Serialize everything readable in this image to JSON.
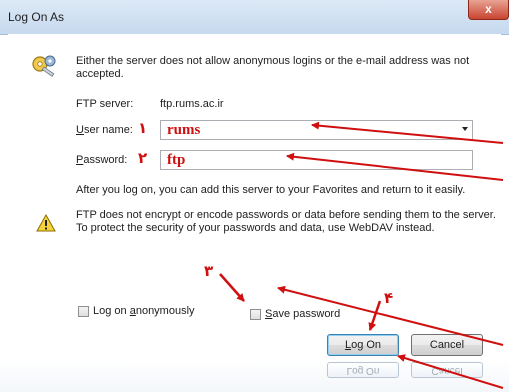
{
  "window": {
    "title": "Log On As",
    "close_glyph": "x"
  },
  "message": "Either the server does not allow anonymous logins or the e-mail address was not accepted.",
  "ftp_server": {
    "label": "FTP server:",
    "value": "ftp.rums.ac.ir"
  },
  "user_name": {
    "label_u": "U",
    "label_rest": "ser name:",
    "value": "rums",
    "marker": "۱"
  },
  "password": {
    "label_u": "P",
    "label_rest": "assword:",
    "value": "ftp",
    "marker": "۲"
  },
  "info_text": "After you log on, you can add this server to your Favorites and return to it easily.",
  "warning_text": "FTP does not encrypt or encode passwords or data before sending them to the server.  To protect the security of your passwords and data, use WebDAV instead.",
  "options": {
    "anonymous_pre": "Log on ",
    "anonymous_u": "a",
    "anonymous_post": "nonymously",
    "anonymous_checked": false,
    "save_u": "S",
    "save_rest": "ave password",
    "save_checked": false,
    "save_marker": "۳"
  },
  "buttons": {
    "logon_u": "L",
    "logon_rest": "og On",
    "cancel": "Cancel",
    "logon_marker": "۴"
  },
  "reflection": {
    "logon": "Log On",
    "cancel": "Cancel"
  },
  "colors": {
    "annotation": "#d01010",
    "title_bar": "#c6d9ee",
    "close": "#c9452f"
  },
  "icons": [
    "keys-icon",
    "warning-icon",
    "chevron-down-icon",
    "close-icon"
  ]
}
